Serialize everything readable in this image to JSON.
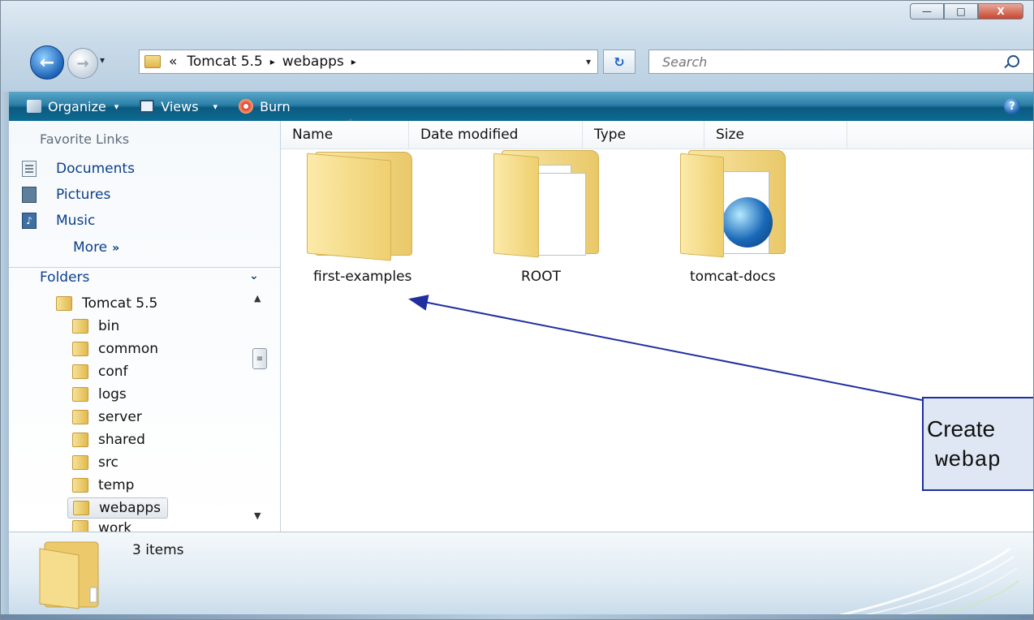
{
  "window": {
    "minimize_label": "—",
    "maximize_label": "□",
    "close_label": "X"
  },
  "address": {
    "overflow": "«",
    "crumbs": [
      "Tomcat 5.5",
      "webapps"
    ],
    "separator": "▸",
    "dropdown": "▾",
    "refresh": "↻"
  },
  "search": {
    "placeholder": "Search"
  },
  "toolbar": {
    "organize": "Organize",
    "views": "Views",
    "burn": "Burn",
    "caret": "▾",
    "help": "?"
  },
  "nav": {
    "favorites_header": "Favorite Links",
    "favorites": [
      "Documents",
      "Pictures",
      "Music"
    ],
    "more": "More",
    "more_glyph": "»",
    "folders_header": "Folders",
    "folders_chevron": "⌄",
    "tree_root": "Tomcat 5.5",
    "tree_children": [
      "bin",
      "common",
      "conf",
      "logs",
      "server",
      "shared",
      "src",
      "temp",
      "webapps",
      "work"
    ],
    "selected": "webapps"
  },
  "columns": {
    "headers": [
      "Name",
      "Date modified",
      "Type",
      "Size"
    ],
    "sort_glyph": "^"
  },
  "items": [
    {
      "name": "first-examples"
    },
    {
      "name": "ROOT"
    },
    {
      "name": "tomcat-docs"
    }
  ],
  "callout": {
    "line1": "Create",
    "line2": "webap"
  },
  "details": {
    "count": "3 items"
  },
  "colors": {
    "toolbar": "#0d6a92",
    "link": "#0b3f8a",
    "callout_border": "#1f2f9e",
    "arrow": "#1f2f9e"
  }
}
